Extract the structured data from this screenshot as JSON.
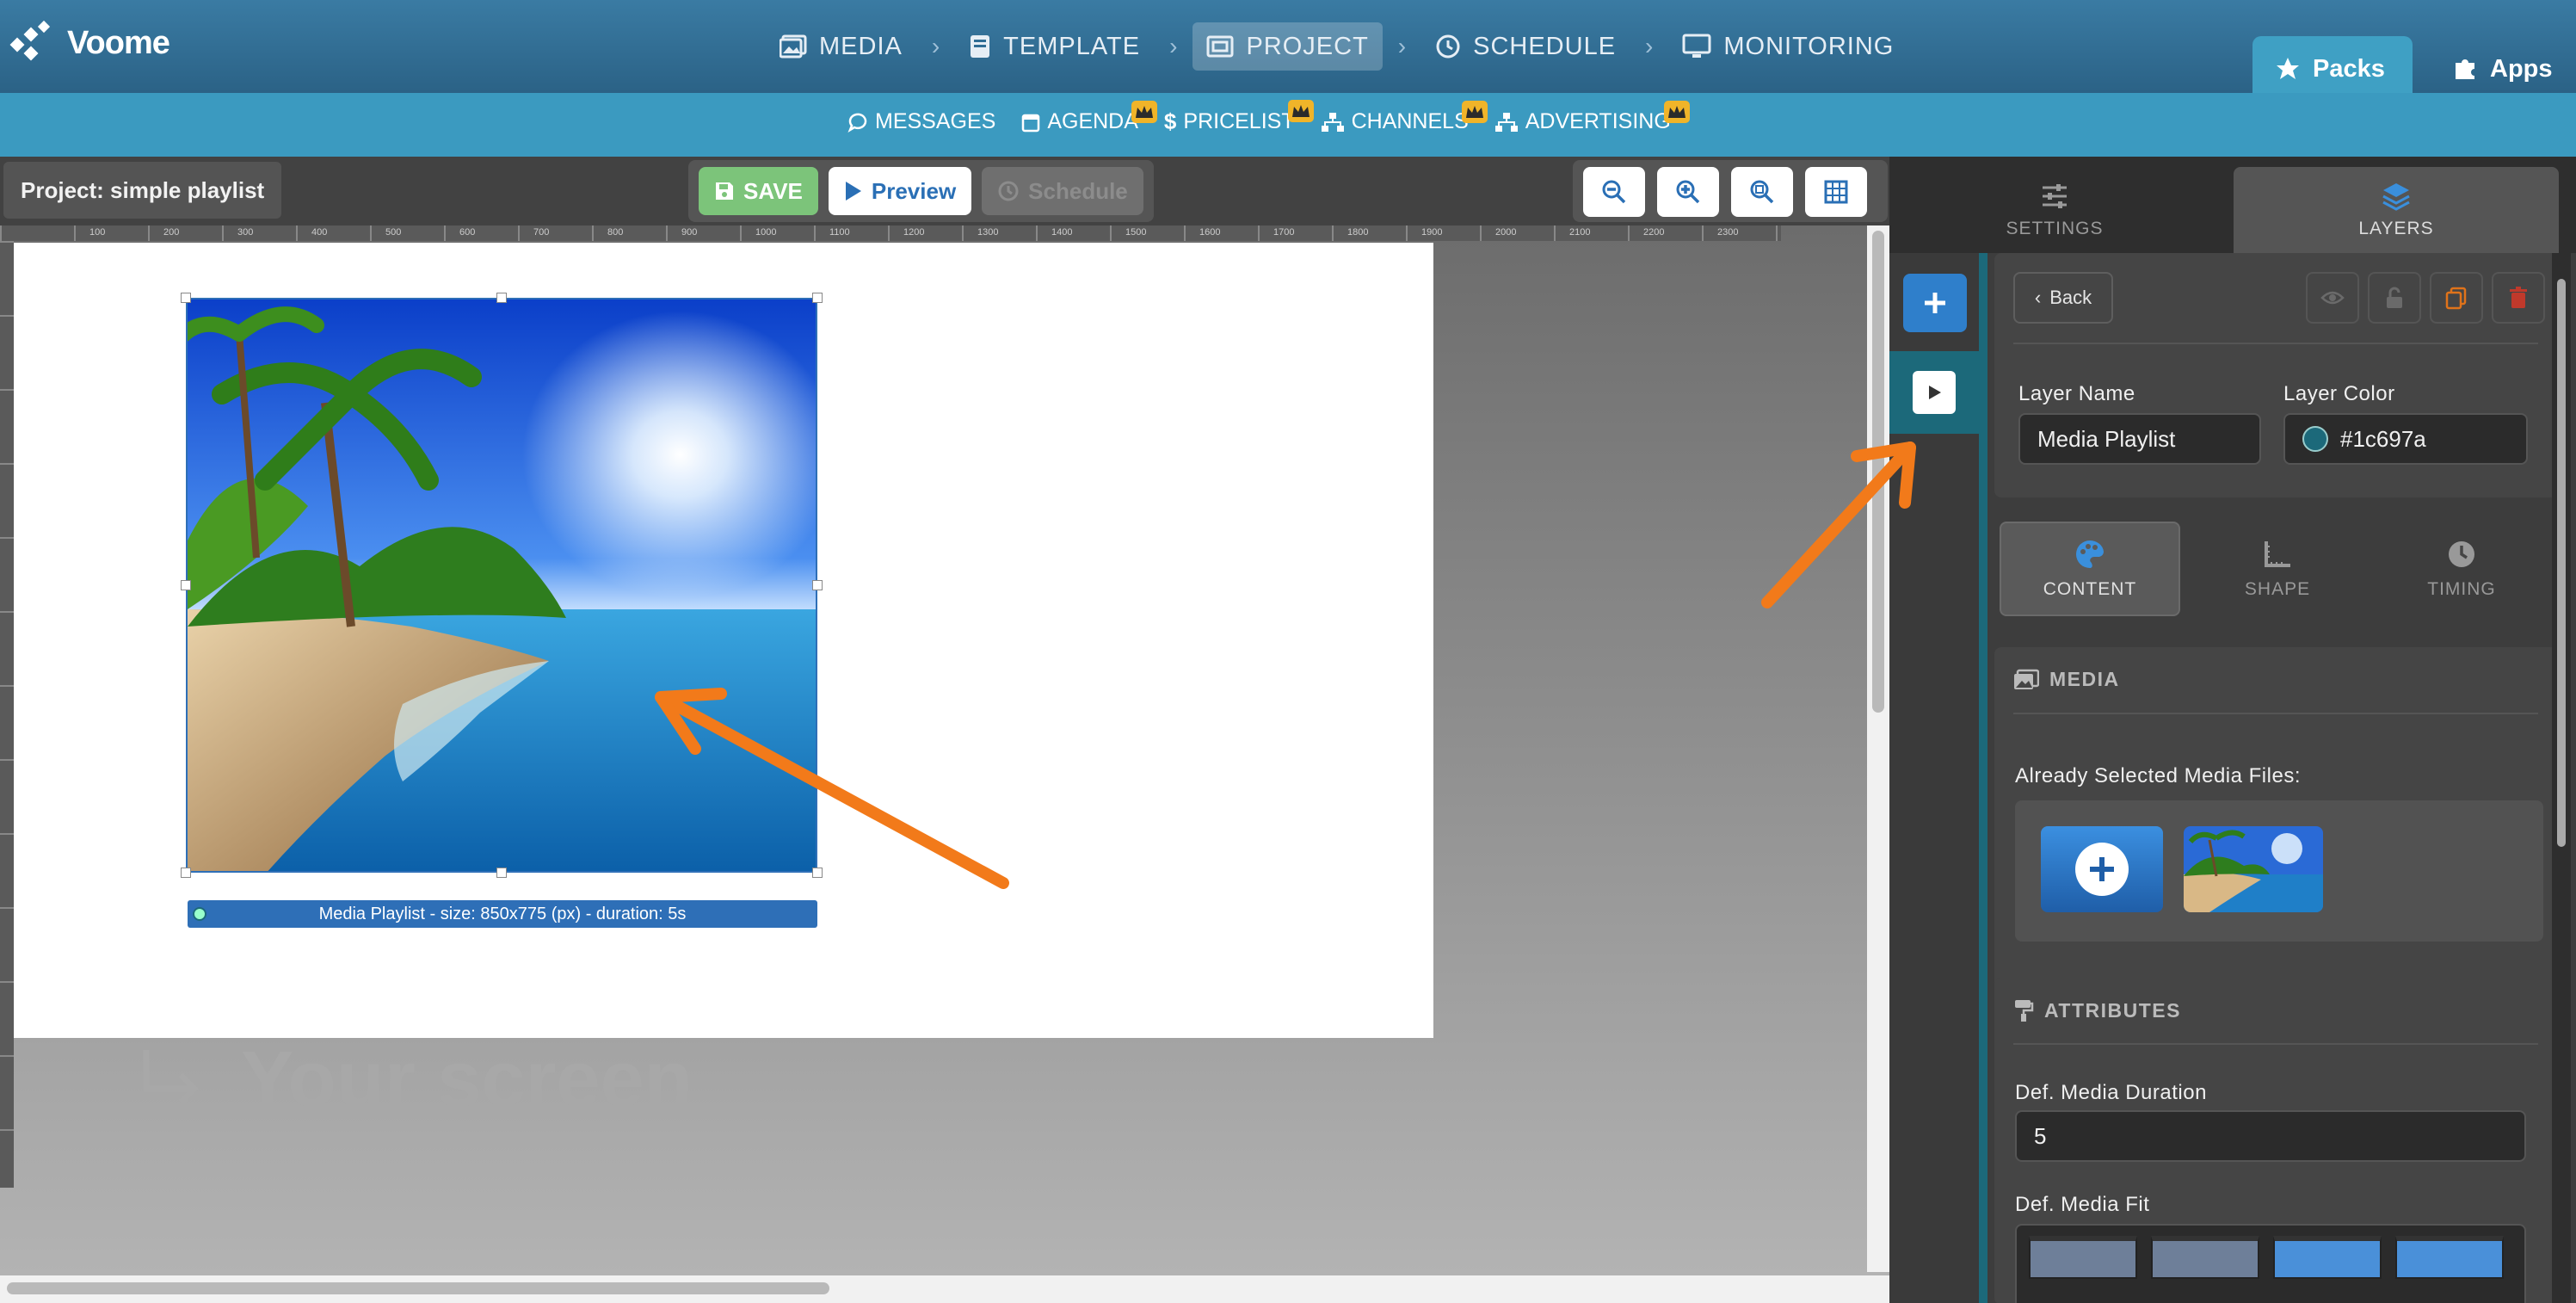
{
  "app": {
    "brand": "Voome"
  },
  "nav": {
    "steps": [
      {
        "label": "MEDIA",
        "icon": "media-icon"
      },
      {
        "label": "TEMPLATE",
        "icon": "book-icon"
      },
      {
        "label": "PROJECT",
        "icon": "project-icon",
        "active": true
      },
      {
        "label": "SCHEDULE",
        "icon": "clock-icon"
      },
      {
        "label": "MONITORING",
        "icon": "monitor-icon"
      }
    ],
    "packs_label": "Packs",
    "apps_label": "Apps"
  },
  "subnav": {
    "items": [
      {
        "label": "MESSAGES",
        "icon": "chat-icon",
        "premium": false
      },
      {
        "label": "AGENDA",
        "icon": "calendar-icon",
        "premium": true
      },
      {
        "label": "PRICELIST",
        "icon": "dollar-icon",
        "premium": true
      },
      {
        "label": "CHANNELS",
        "icon": "sitemap-icon",
        "premium": true
      },
      {
        "label": "ADVERTISING",
        "icon": "sitemap-icon",
        "premium": true
      }
    ]
  },
  "toolbar": {
    "project_label": "Project: simple playlist",
    "save_label": "SAVE",
    "preview_label": "Preview",
    "schedule_label": "Schedule"
  },
  "canvas": {
    "ruler_ticks": [
      "100",
      "200",
      "300",
      "400",
      "500",
      "600",
      "700",
      "800",
      "900",
      "1000",
      "1100",
      "1200",
      "1300",
      "1400",
      "1500",
      "1600",
      "1700",
      "1800",
      "1900",
      "2000",
      "2100",
      "2200",
      "2300"
    ],
    "layer_caption": "Media Playlist - size: 850x775 (px) - duration: 5s",
    "screen_label": "Your screen"
  },
  "right_panel": {
    "tabs": {
      "settings": "SETTINGS",
      "layers": "LAYERS"
    },
    "back_label": "Back",
    "layer_name_label": "Layer Name",
    "layer_name_value": "Media Playlist",
    "layer_color_label": "Layer Color",
    "layer_color_value": "#1c697a",
    "content_tabs": {
      "content": "CONTENT",
      "shape": "SHAPE",
      "timing": "TIMING"
    },
    "media_section": "MEDIA",
    "already_selected_label": "Already Selected Media Files:",
    "attributes_section": "ATTRIBUTES",
    "def_duration_label": "Def. Media Duration",
    "def_duration_value": "5",
    "def_fit_label": "Def. Media Fit"
  },
  "colors": {
    "layer": "#1c697a",
    "accent_blue": "#2e6fb7",
    "annotation_arrow": "#f27a1a",
    "save_green": "#7cc47a"
  }
}
